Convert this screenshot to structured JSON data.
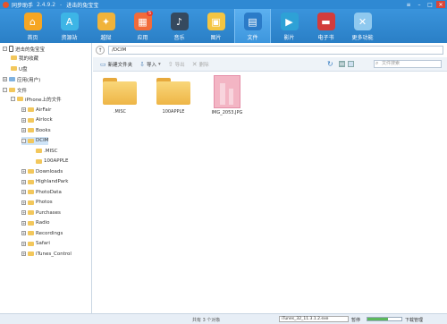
{
  "app": {
    "name": "同步助手",
    "version": "2.4.9.2",
    "device_name": "进击的兔宝宝"
  },
  "toolbar": [
    {
      "label": "首页",
      "icon": "home-icon",
      "color": "#f6a623",
      "glyph": "⌂"
    },
    {
      "label": "资源站",
      "icon": "app-store-icon",
      "color": "#3db5e6",
      "glyph": "A"
    },
    {
      "label": "越狱",
      "icon": "jailbreak-icon",
      "color": "#f0b33a",
      "glyph": "✦"
    },
    {
      "label": "应用",
      "icon": "apps-icon",
      "color": "#f26b3a",
      "glyph": "▦",
      "badge": "5"
    },
    {
      "label": "音乐",
      "icon": "music-icon",
      "color": "#35495e",
      "glyph": "♪"
    },
    {
      "label": "图片",
      "icon": "photos-icon",
      "color": "#f4c542",
      "glyph": "▣"
    },
    {
      "label": "文件",
      "icon": "files-icon",
      "color": "#2b7bc8",
      "glyph": "▤",
      "active": true
    },
    {
      "label": "影片",
      "icon": "video-icon",
      "color": "#2ea1d6",
      "glyph": "▶"
    },
    {
      "label": "电子书",
      "icon": "ebook-icon",
      "color": "#d23c3c",
      "glyph": "▬"
    },
    {
      "label": "更多功能",
      "icon": "tools-icon",
      "color": "#8fc9ef",
      "glyph": "✕"
    }
  ],
  "tree": {
    "device": "进击的兔宝宝",
    "favorites": "我的收藏",
    "udisk": "U盘",
    "apps": "应用(用户)",
    "files": "文件",
    "iphone_files": "iPhone上的文件",
    "folders": [
      "AirFair",
      "Airlock",
      "Books",
      "DCIM",
      "Downloads",
      "HighlandPark",
      "PhotoData",
      "Photos",
      "Purchases",
      "Radio",
      "Recordings",
      "Safari",
      "iTunes_Control"
    ],
    "dcim_children": [
      ".MISC",
      "100APPLE"
    ]
  },
  "path": {
    "current": "/DCIM"
  },
  "actions": {
    "new_folder": "新建文件夹",
    "import": "导入",
    "export": "导出",
    "delete": "删除",
    "search_placeholder": "文件搜索"
  },
  "files": [
    {
      "name": ".MISC",
      "type": "folder"
    },
    {
      "name": "100APPLE",
      "type": "folder"
    },
    {
      "name": "IMG_2053.JPG",
      "type": "image"
    }
  ],
  "status": {
    "count_text": "共有 3 个对象",
    "task_name": "iTunes_32_11.3.1.2.exe",
    "pause_label": "暂停",
    "download_manager": "下载管理",
    "progress": 0.6
  }
}
